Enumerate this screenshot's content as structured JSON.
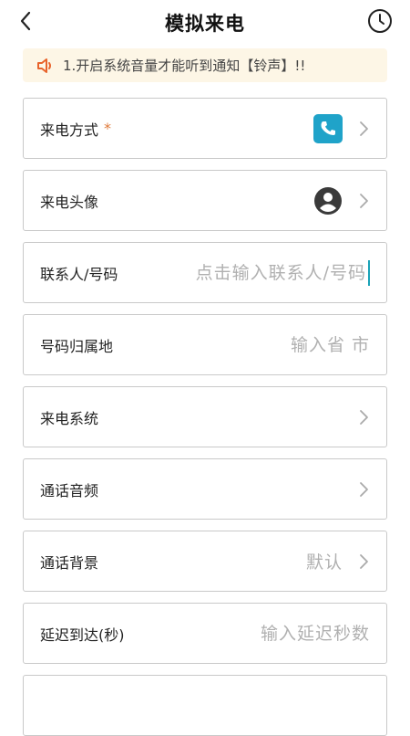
{
  "header": {
    "title": "模拟来电",
    "back_icon": "chevron-left-icon",
    "history_icon": "clock-icon"
  },
  "notice": {
    "icon": "speaker-icon",
    "text": "1.开启系统音量才能听到通知【铃声】!!"
  },
  "rows": {
    "call_method": {
      "label": "来电方式",
      "required": "*",
      "icon": "phone-icon"
    },
    "call_avatar": {
      "label": "来电头像",
      "icon": "user-avatar-icon"
    },
    "contact": {
      "label": "联系人/号码",
      "placeholder": "点击输入联系人/号码",
      "value": ""
    },
    "location": {
      "label": "号码归属地",
      "placeholder": "输入省 市"
    },
    "system": {
      "label": "来电系统"
    },
    "audio": {
      "label": "通话音频"
    },
    "background": {
      "label": "通话背景",
      "value": "默认"
    },
    "delay": {
      "label": "延迟到达(秒)",
      "placeholder": "输入延迟秒数"
    }
  },
  "colors": {
    "accent": "#1fa3c9",
    "notice_bg": "#fdf6e6",
    "notice_icon": "#e8632b",
    "required": "#e07a3a"
  }
}
